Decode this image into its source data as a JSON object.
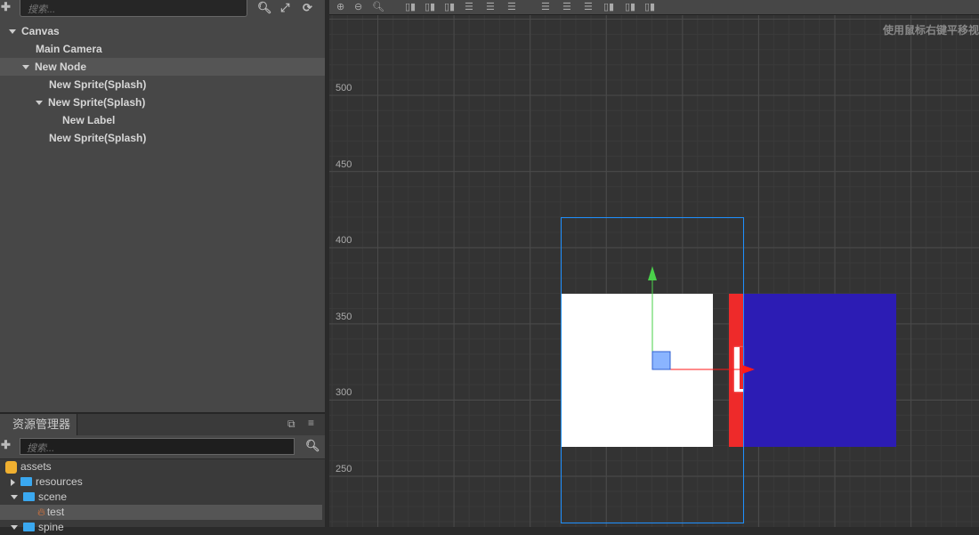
{
  "hierarchy": {
    "search_placeholder": "搜索...",
    "items": [
      {
        "label": "Canvas",
        "depth": 0,
        "expanded": true
      },
      {
        "label": "Main Camera",
        "depth": 1
      },
      {
        "label": "New Node",
        "depth": 1,
        "expanded": true,
        "selected": true
      },
      {
        "label": "New Sprite(Splash)",
        "depth": 2
      },
      {
        "label": "New Sprite(Splash)",
        "depth": 2,
        "expanded": true
      },
      {
        "label": "New Label",
        "depth": 3
      },
      {
        "label": "New Sprite(Splash)",
        "depth": 2
      }
    ]
  },
  "assets": {
    "tab_label": "资源管理器",
    "search_placeholder": "搜索...",
    "items": [
      {
        "label": "assets",
        "type": "db"
      },
      {
        "label": "resources",
        "type": "folder",
        "collapsed": true
      },
      {
        "label": "scene",
        "type": "folder",
        "expanded": true
      },
      {
        "label": "test",
        "type": "scene",
        "selected": true
      },
      {
        "label": "spine",
        "type": "folder",
        "expanded": true
      }
    ]
  },
  "scene": {
    "hint": "使用鼠标右键平移视",
    "y_labels": [
      "500",
      "450",
      "400",
      "350",
      "300",
      "250"
    ],
    "colors": {
      "white_sprite": "#ffffff",
      "red_sprite": "#ee2a2a",
      "blue_sprite": "#2c1cb4",
      "selection": "#1e90ff"
    }
  }
}
